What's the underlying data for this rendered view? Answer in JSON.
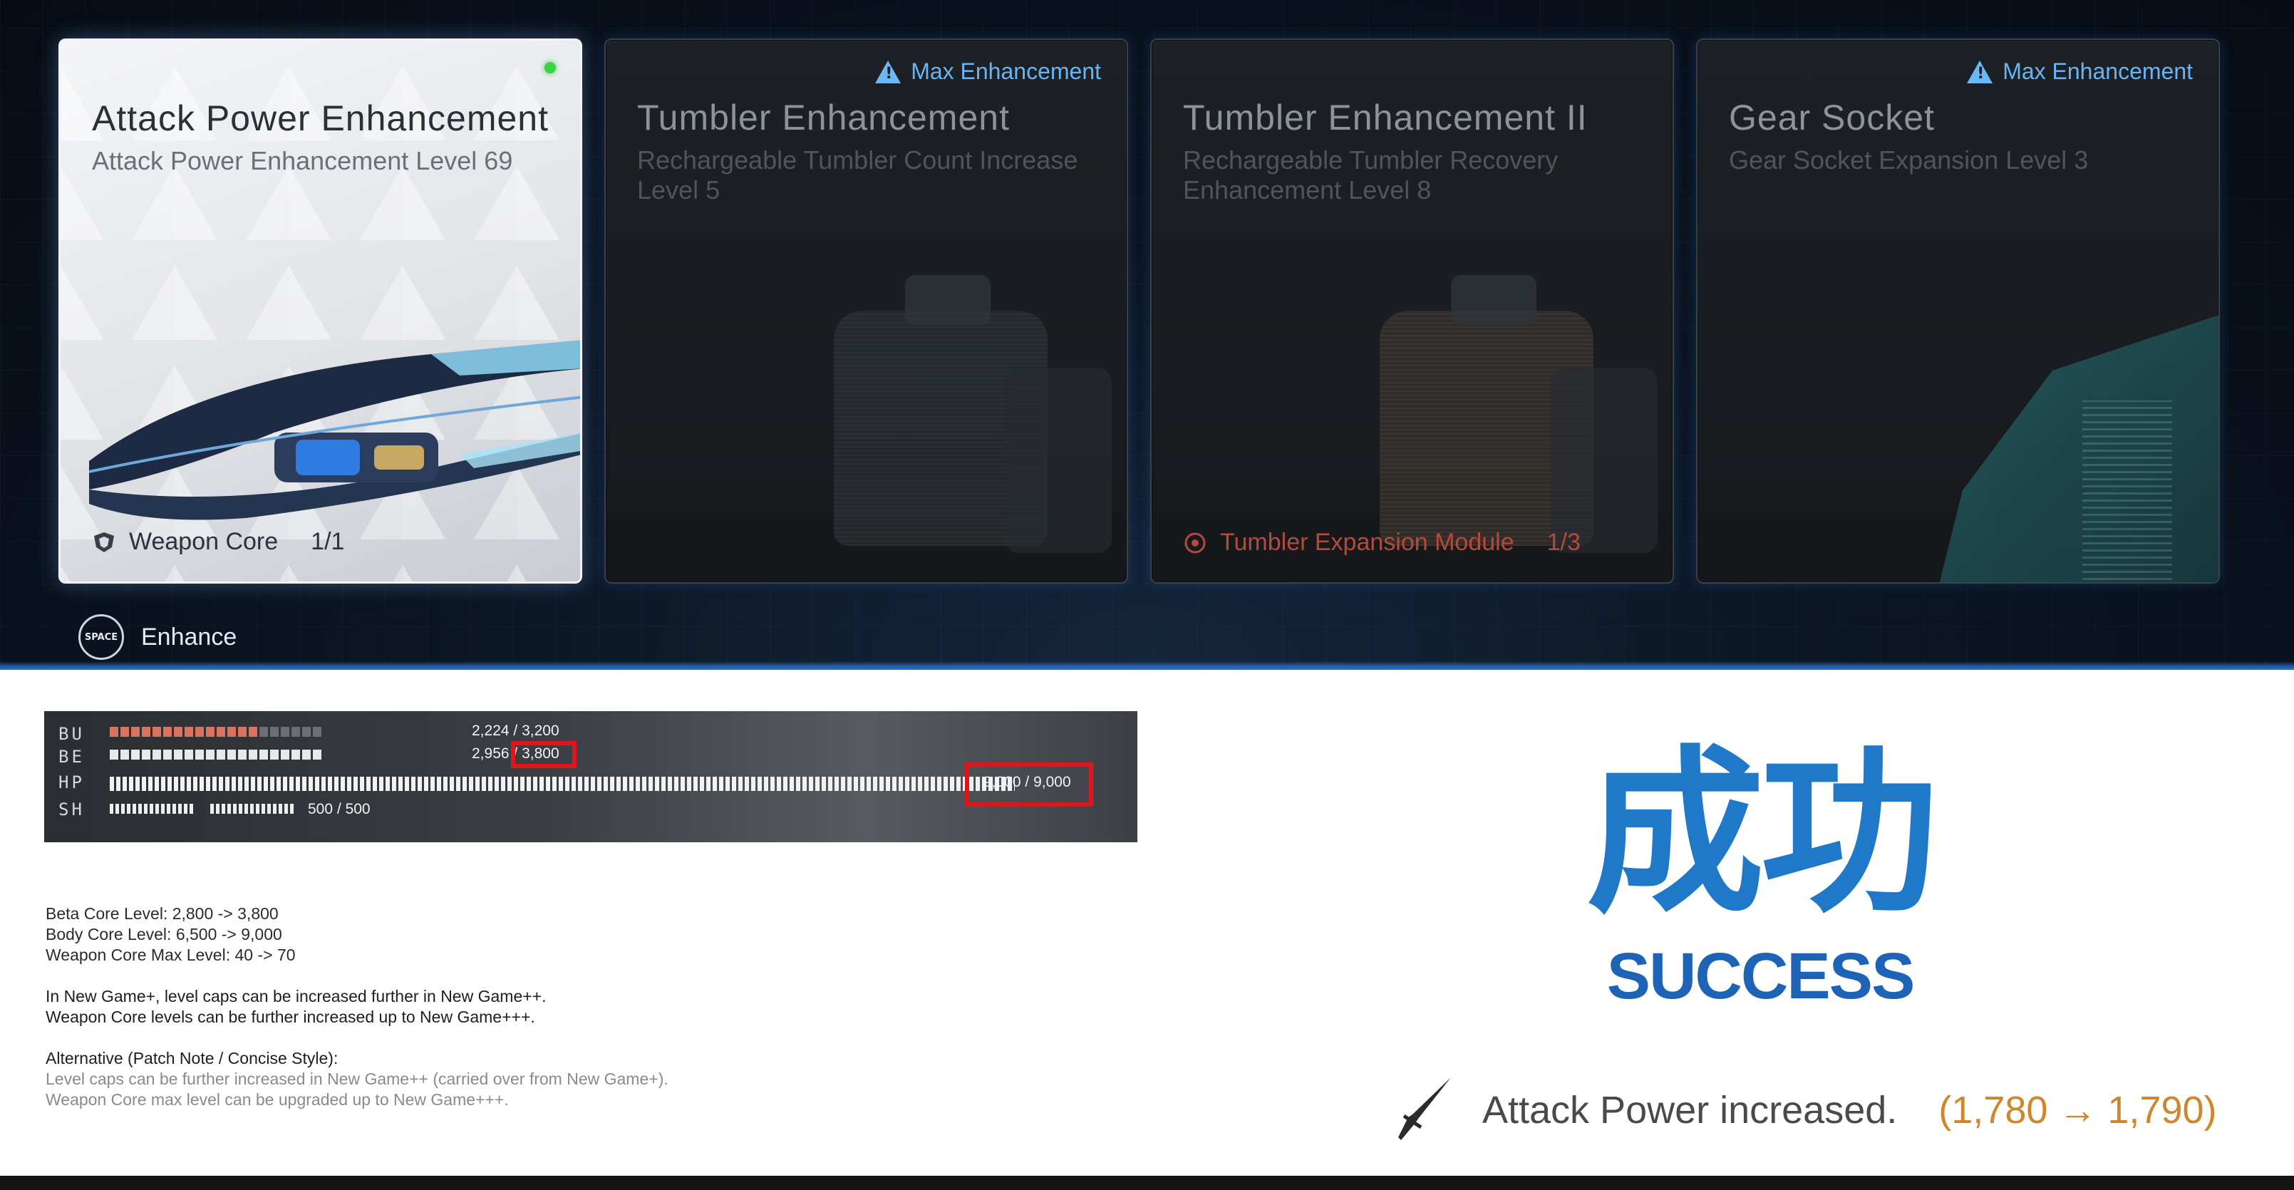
{
  "cards": [
    {
      "title": "Attack Power Enhancement",
      "subtitle": "Attack Power Enhancement Level 69",
      "requirement": {
        "name": "Weapon Core",
        "count": "1/1"
      },
      "status_color": "#3bd24a"
    },
    {
      "title": "Tumbler Enhancement",
      "subtitle": "Rechargeable Tumbler Count Increase Level 5",
      "tag": "Max Enhancement"
    },
    {
      "title": "Tumbler Enhancement II",
      "subtitle": "Rechargeable Tumbler Recovery Enhancement Level 8",
      "requirement": {
        "name": "Tumbler Expansion Module",
        "count": "1/3"
      }
    },
    {
      "title": "Gear Socket",
      "subtitle": "Gear Socket Expansion Level 3",
      "tag": "Max Enhancement"
    }
  ],
  "action": {
    "key": "SPACE",
    "label": "Enhance"
  },
  "hud": {
    "rows": [
      {
        "label": "BU",
        "value": "2,224",
        "max": "3,200",
        "filled": 14,
        "total": 20
      },
      {
        "label": "BE",
        "value": "2,956",
        "max": "3,800",
        "filled": 20,
        "total": 20
      },
      {
        "label": "HP",
        "value": "9,000",
        "max": "9,000"
      },
      {
        "label": "SH",
        "value": "500",
        "max": "500"
      }
    ],
    "sep": "/"
  },
  "notes": {
    "line1": "Beta Core Level: 2,800 -> 3,800",
    "line2": "Body Core Level: 6,500 -> 9,000",
    "line3": "Weapon Core Max Level: 40 -> 70",
    "line4": "In New Game+, level caps can be increased further in New Game++.",
    "line5": "Weapon Core levels can be further increased up to New Game+++.",
    "line6": "Alternative (Patch Note / Concise Style):",
    "line7": "Level caps can be further increased in New Game++ (carried over from New Game+).",
    "line8": "Weapon Core max level can be upgraded up to New Game+++."
  },
  "success": {
    "cjk": "成功",
    "en": "SUCCESS"
  },
  "result": {
    "text": "Attack Power increased.",
    "delta": "(1,780 → 1,790)"
  },
  "colors": {
    "accent_blue": "#1f78c8",
    "delta_orange": "#d0862a",
    "highlight_red": "#e1141a",
    "tag_blue": "#69b4f5"
  }
}
